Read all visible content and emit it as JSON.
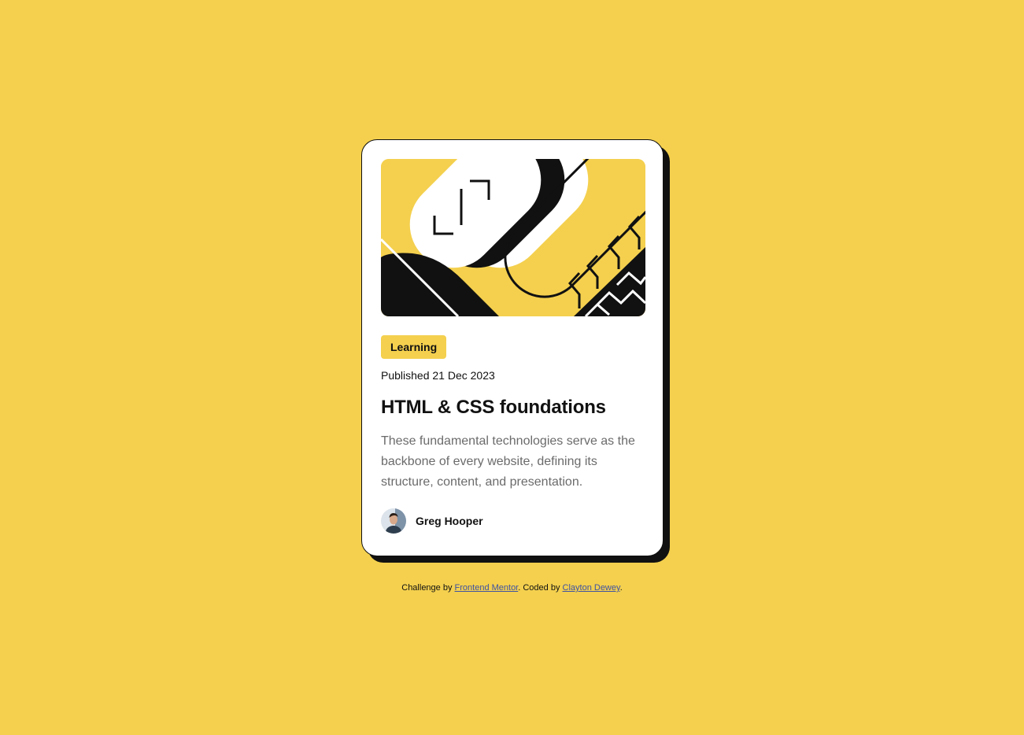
{
  "colors": {
    "background": "#F4D04E",
    "card": "#FFFFFF",
    "ink": "#111111",
    "muted": "#6B6B6B",
    "link": "#3E52A3"
  },
  "card": {
    "tag": "Learning",
    "published": "Published 21 Dec 2023",
    "title": "HTML & CSS foundations",
    "description": "These fundamental technologies serve as the backbone of every website, defining its structure, content, and presentation.",
    "author": {
      "name": "Greg Hooper"
    }
  },
  "attribution": {
    "challenge_prefix": "Challenge by",
    "challenge_link": "Frontend Mentor",
    "coded_prefix": ". Coded by",
    "coded_link": "Clayton Dewey",
    "suffix": "."
  }
}
